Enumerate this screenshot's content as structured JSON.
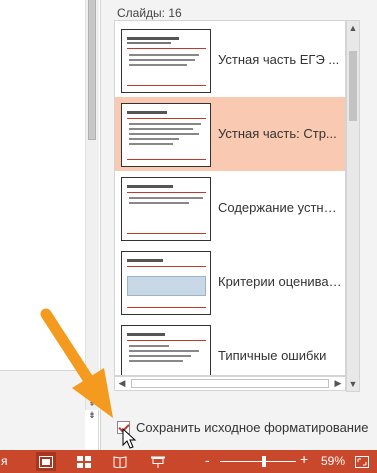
{
  "pane": {
    "slide_count": "Слайды: 16",
    "keep_formatting": "Сохранить исходное форматирование",
    "checked": true
  },
  "slides": [
    {
      "label": "Устная часть ЕГЭ ...",
      "selected": false
    },
    {
      "label": "Устная часть: Стр...",
      "selected": true
    },
    {
      "label": "Содержание устной...",
      "selected": false
    },
    {
      "label": "Критерии оценивания:",
      "selected": false
    },
    {
      "label": "Типичные ошибки",
      "selected": false
    }
  ],
  "statusbar": {
    "left_fragment": "я",
    "zoom_minus": "-",
    "zoom_plus": "+",
    "zoom_level": "59%",
    "zoom_fraction": 0.59
  },
  "icons": {
    "normal_view": "normal-view-icon",
    "sorter_view": "slide-sorter-icon",
    "reading_view": "reading-view-icon",
    "slideshow": "slideshow-icon",
    "fit": "fit-to-window-icon"
  },
  "colors": {
    "accent": "#c9472b",
    "selection": "#f9c9b1",
    "annotation_arrow": "#f39a1f"
  }
}
